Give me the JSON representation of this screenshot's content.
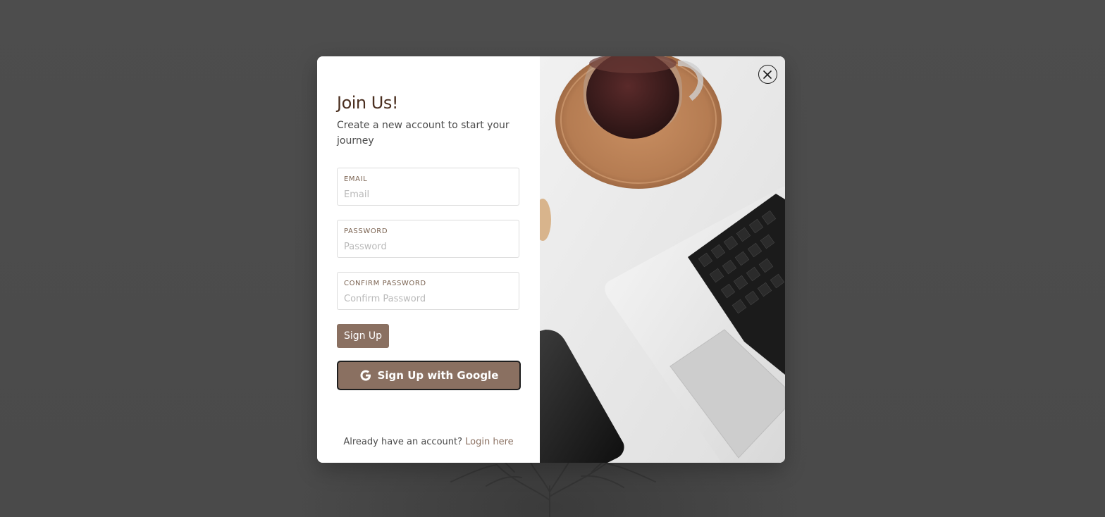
{
  "modal": {
    "title": "Join Us!",
    "subtitle": "Create a new account to start your journey"
  },
  "form": {
    "email": {
      "label": "EMAIL",
      "placeholder": "Email",
      "value": ""
    },
    "password": {
      "label": "PASSWORD",
      "placeholder": "Password",
      "value": ""
    },
    "confirm_password": {
      "label": "CONFIRM PASSWORD",
      "placeholder": "Confirm Password",
      "value": ""
    },
    "signup_label": "Sign Up",
    "google_label": "Sign Up with Google"
  },
  "footer": {
    "prompt": "Already have an account? ",
    "login_label": "Login here"
  },
  "icons": {
    "close": "close-icon",
    "google": "google-icon"
  },
  "colors": {
    "accent": "#8a7061",
    "title": "#4a2e1f",
    "backdrop": "#4c4c4c"
  }
}
